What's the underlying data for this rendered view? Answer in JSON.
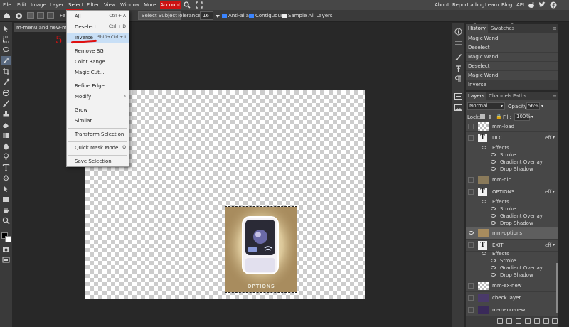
{
  "menubar": {
    "items": [
      "File",
      "Edit",
      "Image",
      "Layer",
      "Select",
      "Filter",
      "View",
      "Window",
      "More"
    ],
    "account": "Account",
    "right_links": [
      "About",
      "Report a bug",
      "Learn",
      "Blog",
      "API"
    ]
  },
  "optbar": {
    "partial_label": "Fe",
    "select_subject": "Select Subject",
    "tolerance_label": "Tolerance:",
    "tolerance_value": "16",
    "anti_alias": "Anti-alias",
    "contiguous": "Contiguous",
    "sample_all": "Sample All Layers"
  },
  "doc_tab": "m-menu and new-menu",
  "annotation": {
    "step": "5",
    "color": "#e01010"
  },
  "select_menu": {
    "items": [
      {
        "label": "All",
        "shortcut": "Ctrl + A"
      },
      {
        "label": "Deselect",
        "shortcut": "Ctrl + D"
      },
      {
        "label": "Inverse",
        "shortcut": "Shift+Ctrl + I"
      },
      {
        "label": "Remove BG",
        "shortcut": ""
      },
      {
        "label": "Color Range...",
        "shortcut": ""
      },
      {
        "label": "Magic Cut...",
        "shortcut": ""
      },
      {
        "label": "Refine Edge...",
        "shortcut": ""
      },
      {
        "label": "Modify",
        "shortcut": "›"
      },
      {
        "label": "Grow",
        "shortcut": ""
      },
      {
        "label": "Similar",
        "shortcut": ""
      },
      {
        "label": "Transform Selection",
        "shortcut": ""
      },
      {
        "label": "Quick Mask Mode",
        "shortcut": "Q"
      },
      {
        "label": "Save Selection",
        "shortcut": ""
      }
    ]
  },
  "canvas": {
    "options_text": "OPTIONS"
  },
  "history": {
    "tabs": [
      "History",
      "Swatches"
    ],
    "rows": [
      "Magic Wand",
      "Deselect",
      "Magic Wand",
      "Deselect",
      "Magic Wand",
      "Inverse"
    ]
  },
  "layers_panel": {
    "tabs": [
      "Layers",
      "Channels",
      "Paths"
    ],
    "blend_mode": "Normal",
    "opacity_label": "Opacity:",
    "opacity_value": "56%",
    "lock_label": "Lock:",
    "fill_label": "Fill:",
    "fill_value": "100%",
    "layers": {
      "mm_load": "mm-load",
      "dlc": "DLC",
      "mm_dlc": "mm-dlc",
      "options": "OPTIONS",
      "mm_options": "mm-options",
      "exit": "EXIT",
      "mm_ex_new": "mm-ex-new",
      "check_layer": "check layer",
      "m_menu_new": "m-menu-new"
    },
    "effects_label": "Effects",
    "effect_names": [
      "Stroke",
      "Gradient Overlay",
      "Drop Shadow"
    ],
    "fx_label": "eff"
  }
}
